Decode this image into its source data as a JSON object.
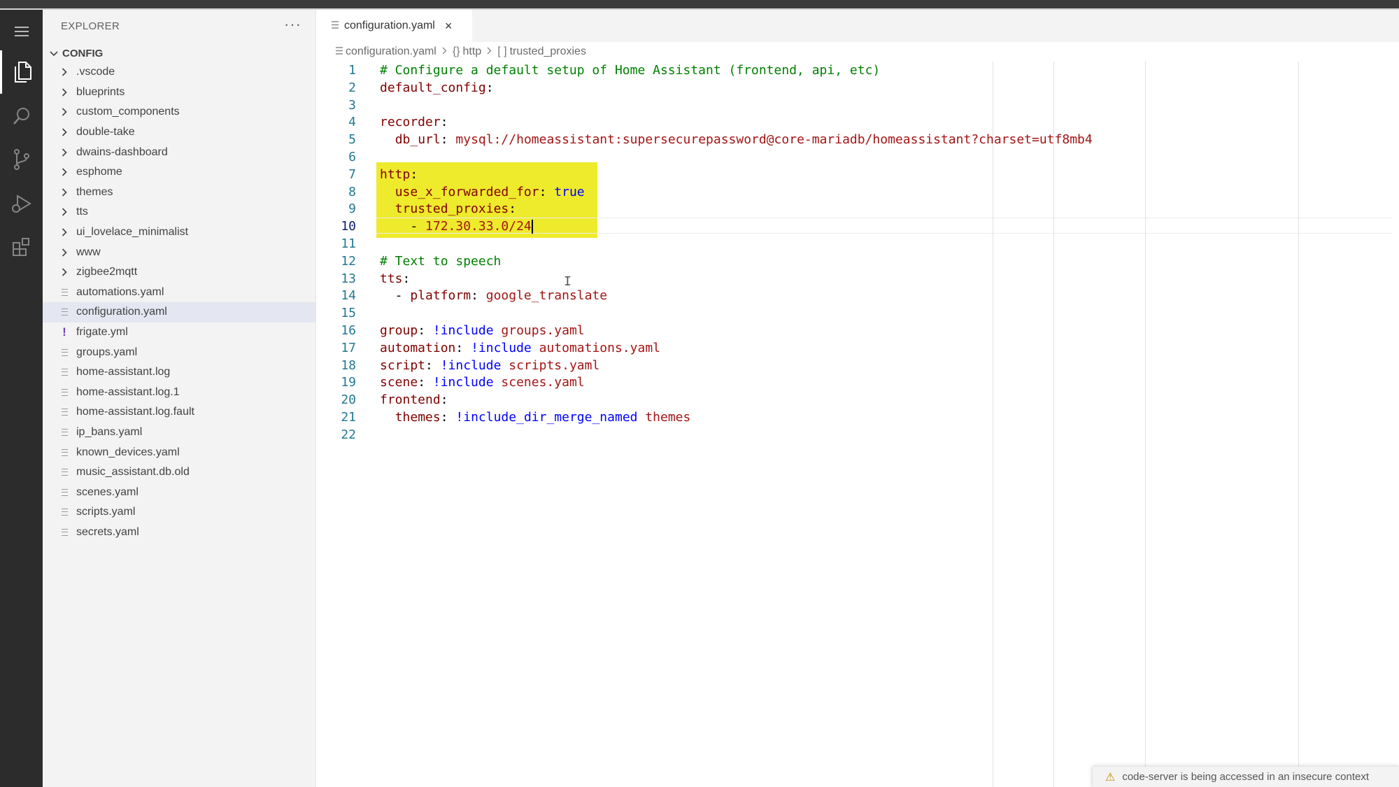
{
  "colors": {
    "activitybar": "#2c2c2c",
    "sidebar": "#f3f3f3",
    "highlight": "#eeea2c",
    "comment": "#008000",
    "key": "#800000",
    "string": "#a31515",
    "keyword": "#0000ff",
    "line_number": "#237893"
  },
  "activitybar": {
    "items": [
      {
        "name": "menu-icon"
      },
      {
        "name": "explorer-icon"
      },
      {
        "name": "search-icon"
      },
      {
        "name": "source-control-icon"
      },
      {
        "name": "run-debug-icon"
      },
      {
        "name": "extensions-icon"
      }
    ]
  },
  "sidebar": {
    "title": "EXPLORER",
    "more": "···",
    "root_label": "CONFIG",
    "items": [
      {
        "label": ".vscode",
        "type": "folder"
      },
      {
        "label": "blueprints",
        "type": "folder"
      },
      {
        "label": "custom_components",
        "type": "folder"
      },
      {
        "label": "double-take",
        "type": "folder"
      },
      {
        "label": "dwains-dashboard",
        "type": "folder"
      },
      {
        "label": "esphome",
        "type": "folder"
      },
      {
        "label": "themes",
        "type": "folder"
      },
      {
        "label": "tts",
        "type": "folder"
      },
      {
        "label": "ui_lovelace_minimalist",
        "type": "folder"
      },
      {
        "label": "www",
        "type": "folder"
      },
      {
        "label": "zigbee2mqtt",
        "type": "folder"
      },
      {
        "label": "automations.yaml",
        "type": "file"
      },
      {
        "label": "configuration.yaml",
        "type": "file",
        "selected": true
      },
      {
        "label": "frigate.yml",
        "type": "warn"
      },
      {
        "label": "groups.yaml",
        "type": "file"
      },
      {
        "label": "home-assistant.log",
        "type": "file"
      },
      {
        "label": "home-assistant.log.1",
        "type": "file"
      },
      {
        "label": "home-assistant.log.fault",
        "type": "file"
      },
      {
        "label": "ip_bans.yaml",
        "type": "file"
      },
      {
        "label": "known_devices.yaml",
        "type": "file"
      },
      {
        "label": "music_assistant.db.old",
        "type": "file"
      },
      {
        "label": "scenes.yaml",
        "type": "file"
      },
      {
        "label": "scripts.yaml",
        "type": "file"
      },
      {
        "label": "secrets.yaml",
        "type": "file"
      }
    ]
  },
  "tab": {
    "label": "configuration.yaml",
    "close": "×"
  },
  "breadcrumb": {
    "file": "configuration.yaml",
    "sym1_icon": "{}",
    "sym1": "http",
    "sym2_icon": "[ ]",
    "sym2": "trusted_proxies"
  },
  "editor": {
    "current_line": 10,
    "lines": [
      {
        "n": "1",
        "tokens": [
          {
            "t": "# Configure a default setup of Home Assistant (frontend, api, etc)",
            "c": "com"
          }
        ]
      },
      {
        "n": "2",
        "tokens": [
          {
            "t": "default_config",
            "c": "key"
          },
          {
            "t": ":",
            "c": ""
          }
        ]
      },
      {
        "n": "3",
        "tokens": []
      },
      {
        "n": "4",
        "tokens": [
          {
            "t": "recorder",
            "c": "key"
          },
          {
            "t": ":",
            "c": ""
          }
        ]
      },
      {
        "n": "5",
        "tokens": [
          {
            "t": "  ",
            "c": ""
          },
          {
            "t": "db_url",
            "c": "key"
          },
          {
            "t": ": ",
            "c": ""
          },
          {
            "t": "mysql://homeassistant:supersecurepassword@core-mariadb/homeassistant?charset=utf8mb4",
            "c": "str"
          }
        ]
      },
      {
        "n": "6",
        "tokens": []
      },
      {
        "n": "7",
        "tokens": [
          {
            "t": "http",
            "c": "key"
          },
          {
            "t": ":",
            "c": ""
          }
        ]
      },
      {
        "n": "8",
        "tokens": [
          {
            "t": "  ",
            "c": ""
          },
          {
            "t": "use_x_forwarded_for",
            "c": "key"
          },
          {
            "t": ": ",
            "c": ""
          },
          {
            "t": "true",
            "c": "kw"
          }
        ]
      },
      {
        "n": "9",
        "tokens": [
          {
            "t": "  ",
            "c": ""
          },
          {
            "t": "trusted_proxies",
            "c": "key"
          },
          {
            "t": ":",
            "c": ""
          }
        ]
      },
      {
        "n": "10",
        "tokens": [
          {
            "t": "    - ",
            "c": ""
          },
          {
            "t": "172.30.33.0/24",
            "c": "str"
          }
        ],
        "cursor": true
      },
      {
        "n": "11",
        "tokens": []
      },
      {
        "n": "12",
        "tokens": [
          {
            "t": "# Text to speech",
            "c": "com"
          }
        ]
      },
      {
        "n": "13",
        "tokens": [
          {
            "t": "tts",
            "c": "key"
          },
          {
            "t": ":",
            "c": ""
          }
        ]
      },
      {
        "n": "14",
        "tokens": [
          {
            "t": "  - ",
            "c": ""
          },
          {
            "t": "platform",
            "c": "key"
          },
          {
            "t": ": ",
            "c": ""
          },
          {
            "t": "google_translate",
            "c": "str"
          }
        ]
      },
      {
        "n": "15",
        "tokens": []
      },
      {
        "n": "16",
        "tokens": [
          {
            "t": "group",
            "c": "key"
          },
          {
            "t": ": ",
            "c": ""
          },
          {
            "t": "!include",
            "c": "tag"
          },
          {
            "t": " groups.yaml",
            "c": "str"
          }
        ]
      },
      {
        "n": "17",
        "tokens": [
          {
            "t": "automation",
            "c": "key"
          },
          {
            "t": ": ",
            "c": ""
          },
          {
            "t": "!include",
            "c": "tag"
          },
          {
            "t": " automations.yaml",
            "c": "str"
          }
        ]
      },
      {
        "n": "18",
        "tokens": [
          {
            "t": "script",
            "c": "key"
          },
          {
            "t": ": ",
            "c": ""
          },
          {
            "t": "!include",
            "c": "tag"
          },
          {
            "t": " scripts.yaml",
            "c": "str"
          }
        ]
      },
      {
        "n": "19",
        "tokens": [
          {
            "t": "scene",
            "c": "key"
          },
          {
            "t": ": ",
            "c": ""
          },
          {
            "t": "!include",
            "c": "tag"
          },
          {
            "t": " scenes.yaml",
            "c": "str"
          }
        ]
      },
      {
        "n": "20",
        "tokens": [
          {
            "t": "frontend",
            "c": "key"
          },
          {
            "t": ":",
            "c": ""
          }
        ]
      },
      {
        "n": "21",
        "tokens": [
          {
            "t": "  ",
            "c": ""
          },
          {
            "t": "themes",
            "c": "key"
          },
          {
            "t": ": ",
            "c": ""
          },
          {
            "t": "!include_dir_merge_named",
            "c": "tag"
          },
          {
            "t": " themes",
            "c": "str"
          }
        ]
      },
      {
        "n": "22",
        "tokens": []
      }
    ]
  },
  "toast": {
    "text": "code-server is being accessed in an insecure context"
  }
}
